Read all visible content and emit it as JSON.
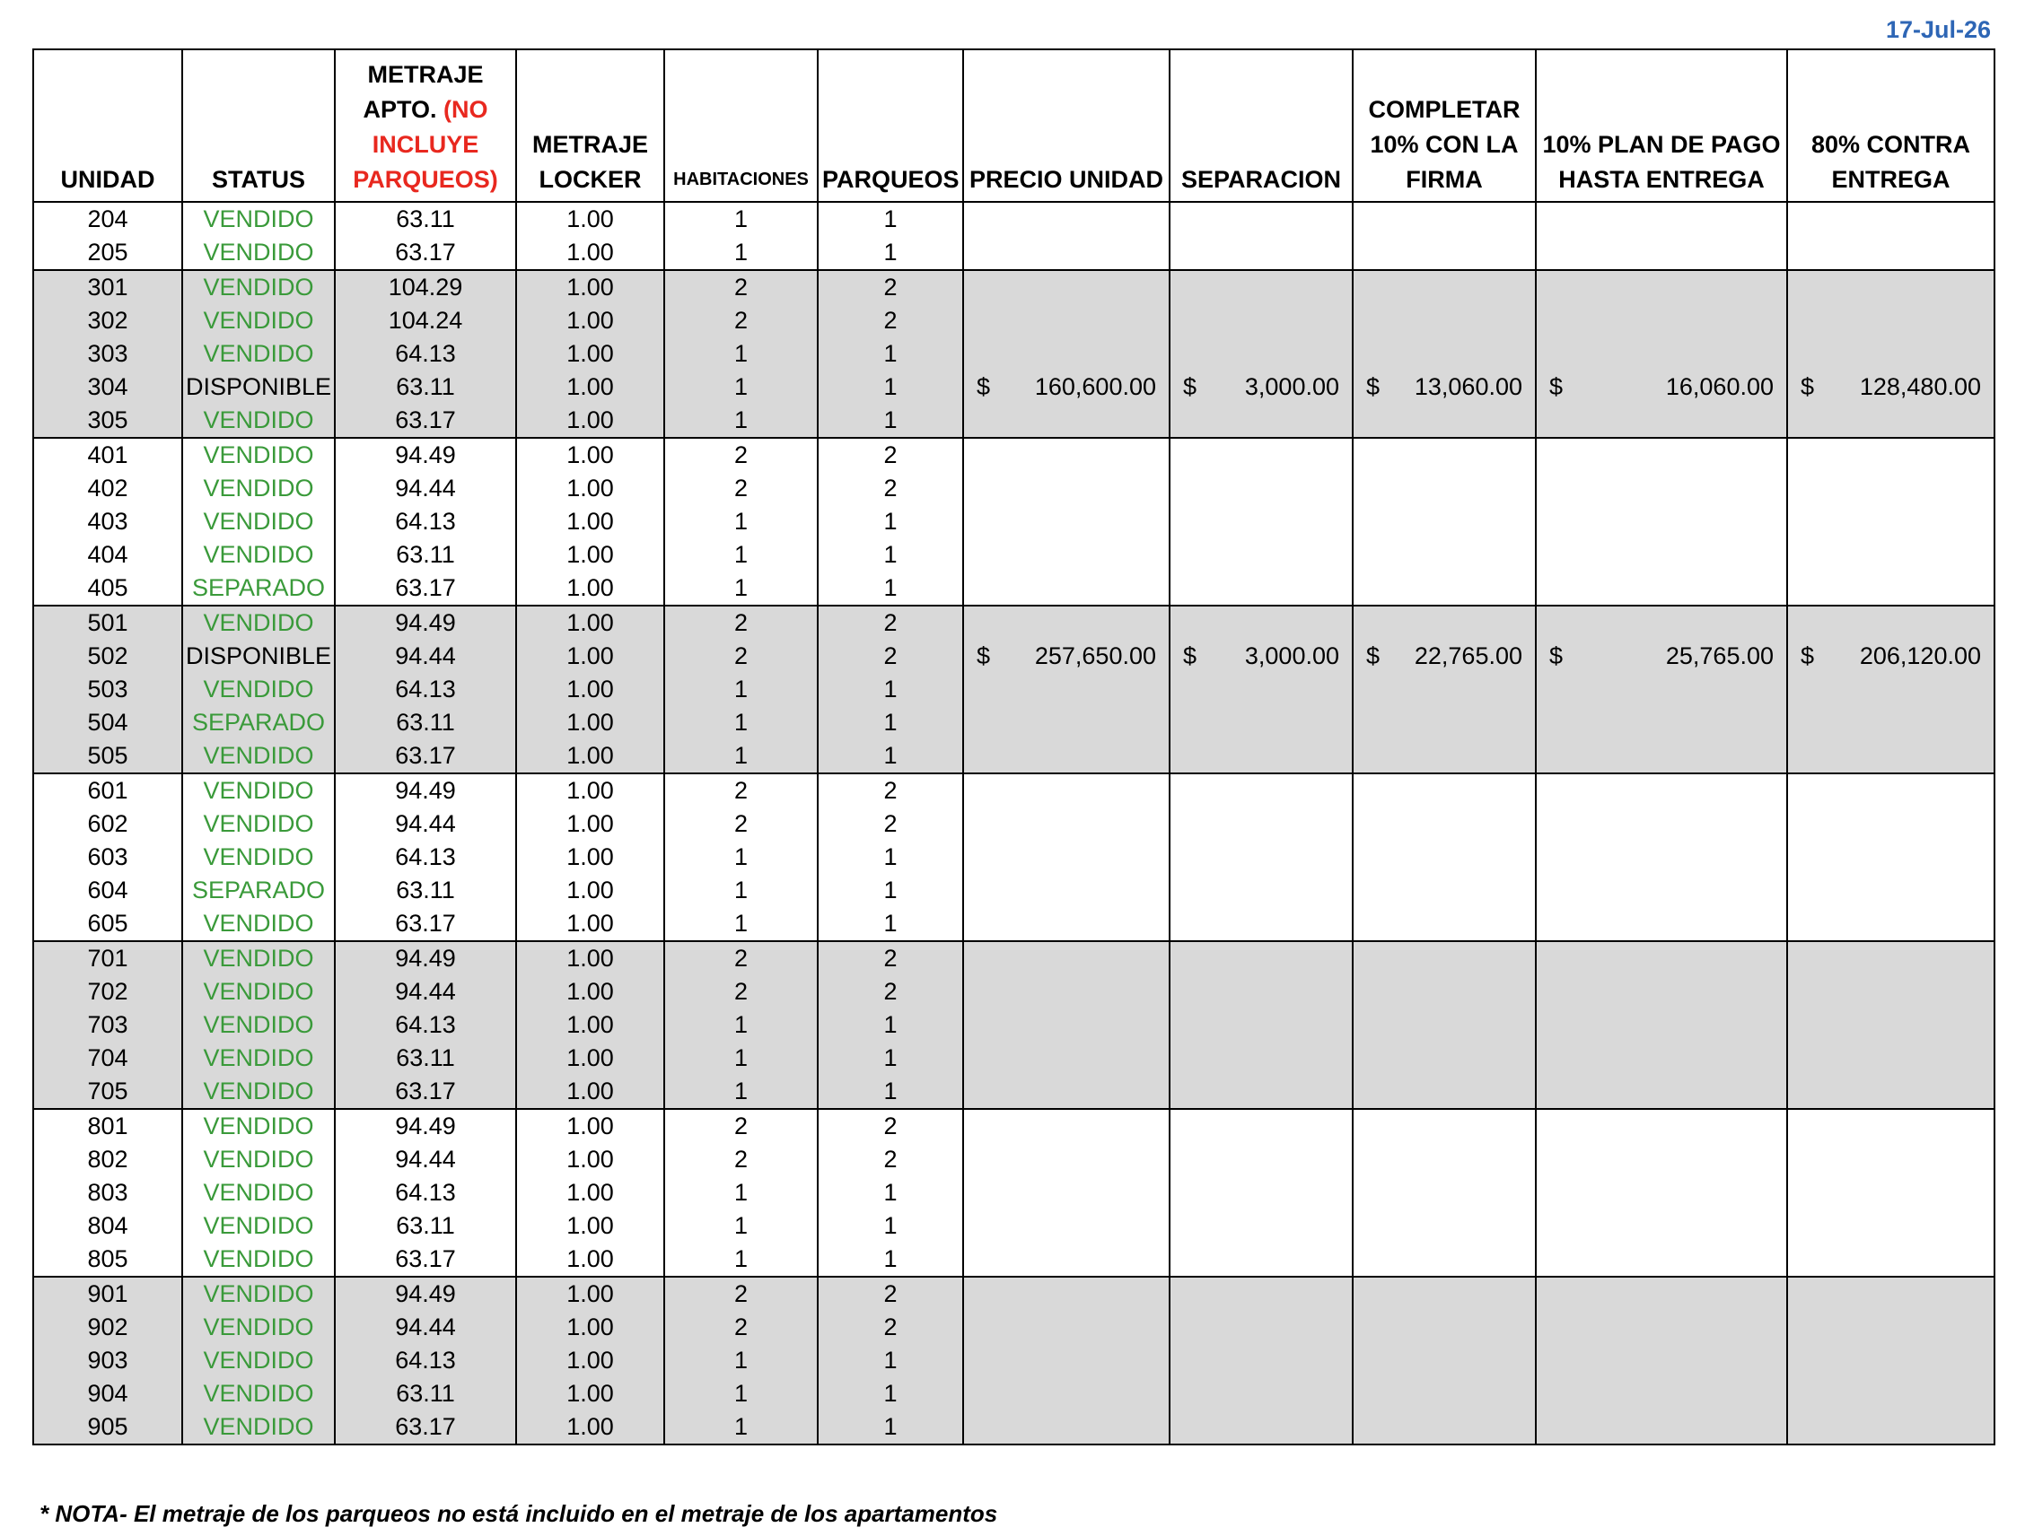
{
  "date": "17-Jul-26",
  "headers": {
    "unidad": "UNIDAD",
    "status": "STATUS",
    "metraje_apto_line1": "METRAJE",
    "metraje_apto_line2": "APTO.",
    "metraje_apto_note_open": "(NO",
    "metraje_apto_note_line2": "INCLUYE",
    "metraje_apto_note_line3": "PARQUEOS)",
    "metraje_locker_line1": "METRAJE",
    "metraje_locker_line2": "LOCKER",
    "habitaciones": "HABITACIONES",
    "parqueos": "PARQUEOS",
    "precio_unidad": "PRECIO UNIDAD",
    "separacion": "SEPARACION",
    "completar_line1": "COMPLETAR",
    "completar_line2": "10% CON LA",
    "completar_line3": "FIRMA",
    "plan_line1": "10% PLAN DE PAGO",
    "plan_line2": "HASTA ENTREGA",
    "contra_line1": "80% CONTRA",
    "contra_line2": "ENTREGA"
  },
  "groups": [
    {
      "shaded": false,
      "rows": [
        [
          "204",
          "VENDIDO",
          "63.11",
          "1.00",
          "1",
          "1"
        ],
        [
          "205",
          "VENDIDO",
          "63.17",
          "1.00",
          "1",
          "1"
        ]
      ]
    },
    {
      "shaded": true,
      "rows": [
        [
          "301",
          "VENDIDO",
          "104.29",
          "1.00",
          "2",
          "2"
        ],
        [
          "302",
          "VENDIDO",
          "104.24",
          "1.00",
          "2",
          "2"
        ],
        [
          "303",
          "VENDIDO",
          "64.13",
          "1.00",
          "1",
          "1"
        ],
        [
          "304",
          "DISPONIBLE",
          "63.11",
          "1.00",
          "1",
          "1"
        ],
        [
          "305",
          "VENDIDO",
          "63.17",
          "1.00",
          "1",
          "1"
        ]
      ]
    },
    {
      "shaded": false,
      "rows": [
        [
          "401",
          "VENDIDO",
          "94.49",
          "1.00",
          "2",
          "2"
        ],
        [
          "402",
          "VENDIDO",
          "94.44",
          "1.00",
          "2",
          "2"
        ],
        [
          "403",
          "VENDIDO",
          "64.13",
          "1.00",
          "1",
          "1"
        ],
        [
          "404",
          "VENDIDO",
          "63.11",
          "1.00",
          "1",
          "1"
        ],
        [
          "405",
          "SEPARADO",
          "63.17",
          "1.00",
          "1",
          "1"
        ]
      ]
    },
    {
      "shaded": true,
      "rows": [
        [
          "501",
          "VENDIDO",
          "94.49",
          "1.00",
          "2",
          "2"
        ],
        [
          "502",
          "DISPONIBLE",
          "94.44",
          "1.00",
          "2",
          "2"
        ],
        [
          "503",
          "VENDIDO",
          "64.13",
          "1.00",
          "1",
          "1"
        ],
        [
          "504",
          "SEPARADO",
          "63.11",
          "1.00",
          "1",
          "1"
        ],
        [
          "505",
          "VENDIDO",
          "63.17",
          "1.00",
          "1",
          "1"
        ]
      ]
    },
    {
      "shaded": false,
      "rows": [
        [
          "601",
          "VENDIDO",
          "94.49",
          "1.00",
          "2",
          "2"
        ],
        [
          "602",
          "VENDIDO",
          "94.44",
          "1.00",
          "2",
          "2"
        ],
        [
          "603",
          "VENDIDO",
          "64.13",
          "1.00",
          "1",
          "1"
        ],
        [
          "604",
          "SEPARADO",
          "63.11",
          "1.00",
          "1",
          "1"
        ],
        [
          "605",
          "VENDIDO",
          "63.17",
          "1.00",
          "1",
          "1"
        ]
      ]
    },
    {
      "shaded": true,
      "rows": [
        [
          "701",
          "VENDIDO",
          "94.49",
          "1.00",
          "2",
          "2"
        ],
        [
          "702",
          "VENDIDO",
          "94.44",
          "1.00",
          "2",
          "2"
        ],
        [
          "703",
          "VENDIDO",
          "64.13",
          "1.00",
          "1",
          "1"
        ],
        [
          "704",
          "VENDIDO",
          "63.11",
          "1.00",
          "1",
          "1"
        ],
        [
          "705",
          "VENDIDO",
          "63.17",
          "1.00",
          "1",
          "1"
        ]
      ]
    },
    {
      "shaded": false,
      "rows": [
        [
          "801",
          "VENDIDO",
          "94.49",
          "1.00",
          "2",
          "2"
        ],
        [
          "802",
          "VENDIDO",
          "94.44",
          "1.00",
          "2",
          "2"
        ],
        [
          "803",
          "VENDIDO",
          "64.13",
          "1.00",
          "1",
          "1"
        ],
        [
          "804",
          "VENDIDO",
          "63.11",
          "1.00",
          "1",
          "1"
        ],
        [
          "805",
          "VENDIDO",
          "63.17",
          "1.00",
          "1",
          "1"
        ]
      ]
    },
    {
      "shaded": true,
      "rows": [
        [
          "901",
          "VENDIDO",
          "94.49",
          "1.00",
          "2",
          "2"
        ],
        [
          "902",
          "VENDIDO",
          "94.44",
          "1.00",
          "2",
          "2"
        ],
        [
          "903",
          "VENDIDO",
          "64.13",
          "1.00",
          "1",
          "1"
        ],
        [
          "904",
          "VENDIDO",
          "63.11",
          "1.00",
          "1",
          "1"
        ],
        [
          "905",
          "VENDIDO",
          "63.17",
          "1.00",
          "1",
          "1"
        ]
      ]
    }
  ],
  "prices": {
    "304": {
      "currency": "$",
      "precio": "160,600.00",
      "separacion": "3,000.00",
      "completar": "13,060.00",
      "plan": "16,060.00",
      "contra": "128,480.00"
    },
    "502": {
      "currency": "$",
      "precio": "257,650.00",
      "separacion": "3,000.00",
      "completar": "22,765.00",
      "plan": "25,765.00",
      "contra": "206,120.00"
    }
  },
  "note": "* NOTA- El metraje de los parqueos no está incluido en el metraje de los apartamentos",
  "colors": {
    "date": "#2e66b5",
    "vendido": "#3a9a3a",
    "separado": "#3a9a3a",
    "disponible": "#000000",
    "header_note": "#e8281f",
    "shaded_row": "#d9d9d9"
  }
}
